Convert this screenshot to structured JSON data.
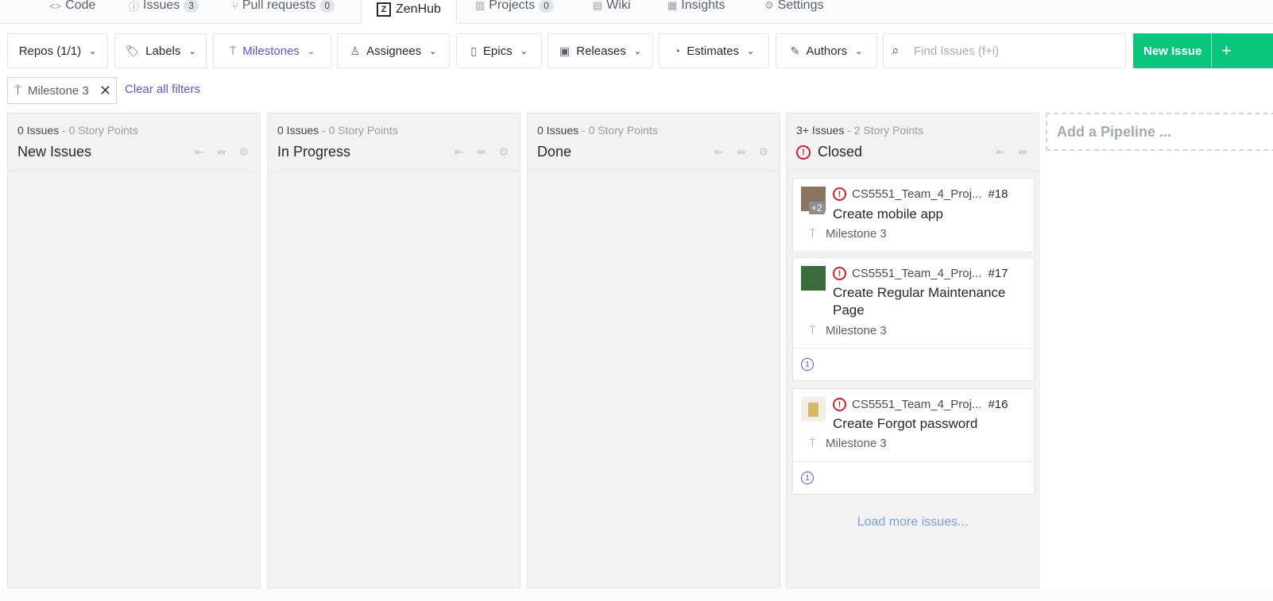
{
  "nav": {
    "tabs": [
      {
        "label": "Code",
        "icon": "code-icon"
      },
      {
        "label": "Issues",
        "count": "3",
        "icon": "issue-icon"
      },
      {
        "label": "Pull requests",
        "count": "0",
        "icon": "pull-request-icon"
      },
      {
        "label": "ZenHub",
        "icon": "zenhub-logo",
        "active": true
      },
      {
        "label": "Projects",
        "count": "0",
        "icon": "project-icon"
      },
      {
        "label": "Wiki",
        "icon": "book-icon"
      },
      {
        "label": "Insights",
        "icon": "graph-icon"
      },
      {
        "label": "Settings",
        "icon": "gear-icon"
      }
    ]
  },
  "filters": {
    "repos": "Repos (1/1)",
    "labels": "Labels",
    "milestones": "Milestones",
    "assignees": "Assignees",
    "epics": "Epics",
    "releases": "Releases",
    "estimates": "Estimates",
    "authors": "Authors",
    "search_placeholder": "Find Issues (f+i)",
    "new_issue": "New Issue",
    "plus": "+"
  },
  "active_filters": {
    "chip": "Milestone 3",
    "clear": "Clear all filters"
  },
  "pipelines": [
    {
      "count": "0 Issues",
      "points": "- 0 Story Points",
      "name": "New Issues"
    },
    {
      "count": "0 Issues",
      "points": "- 0 Story Points",
      "name": "In Progress"
    },
    {
      "count": "0 Issues",
      "points": "- 0 Story Points",
      "name": "Done"
    },
    {
      "count": "3+ Issues",
      "points": "- 2 Story Points",
      "name": "Closed",
      "cards": [
        {
          "repo": "CS5551_Team_4_Proj...",
          "number": "#18",
          "title": "Create mobile app",
          "milestone": "Milestone 3",
          "extra_assignees": "+2"
        },
        {
          "repo": "CS5551_Team_4_Proj...",
          "number": "#17",
          "title": "Create Regular Maintenance Page",
          "milestone": "Milestone 3",
          "estimate": "1"
        },
        {
          "repo": "CS5551_Team_4_Proj...",
          "number": "#16",
          "title": "Create Forgot password",
          "milestone": "Milestone 3",
          "estimate": "1"
        }
      ],
      "load_more": "Load more issues..."
    }
  ],
  "add_pipeline": "Add a Pipeline ...",
  "colors": {
    "accent": "#5f55c7",
    "new_issue_bg": "#0bc57f",
    "closed": "#cb2431"
  }
}
